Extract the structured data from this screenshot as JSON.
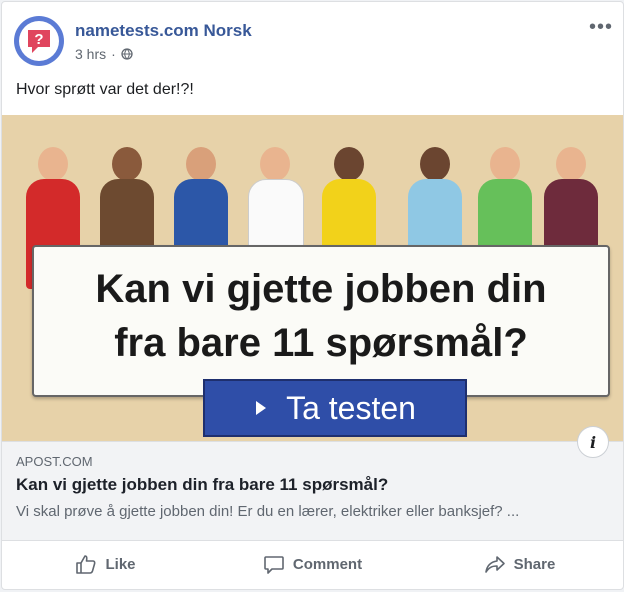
{
  "post": {
    "page_name": "nametests.com Norsk",
    "time": "3 hrs",
    "audience_icon": "globe-icon",
    "more_icon": "more-options-icon",
    "more_text": "•••",
    "text": "Hvor sprøtt var det der!?!"
  },
  "banner": {
    "line1": "Kan vi gjette jobben din",
    "line2": "fra bare 11 spørsmål?",
    "cta_label": "Ta testen",
    "colors": {
      "background": "#e7d2a9",
      "cta": "#2f4ea8"
    }
  },
  "link": {
    "domain": "APOST.COM",
    "title": "Kan vi gjette jobben din fra bare 11 spørsmål?",
    "description": "Vi skal prøve å gjette jobben din! Er du en lærer, elektriker eller banksjef? ...",
    "info_label": "i"
  },
  "actions": {
    "like": "Like",
    "comment": "Comment",
    "share": "Share"
  },
  "colors": {
    "page_name": "#385898",
    "muted": "#606770"
  }
}
